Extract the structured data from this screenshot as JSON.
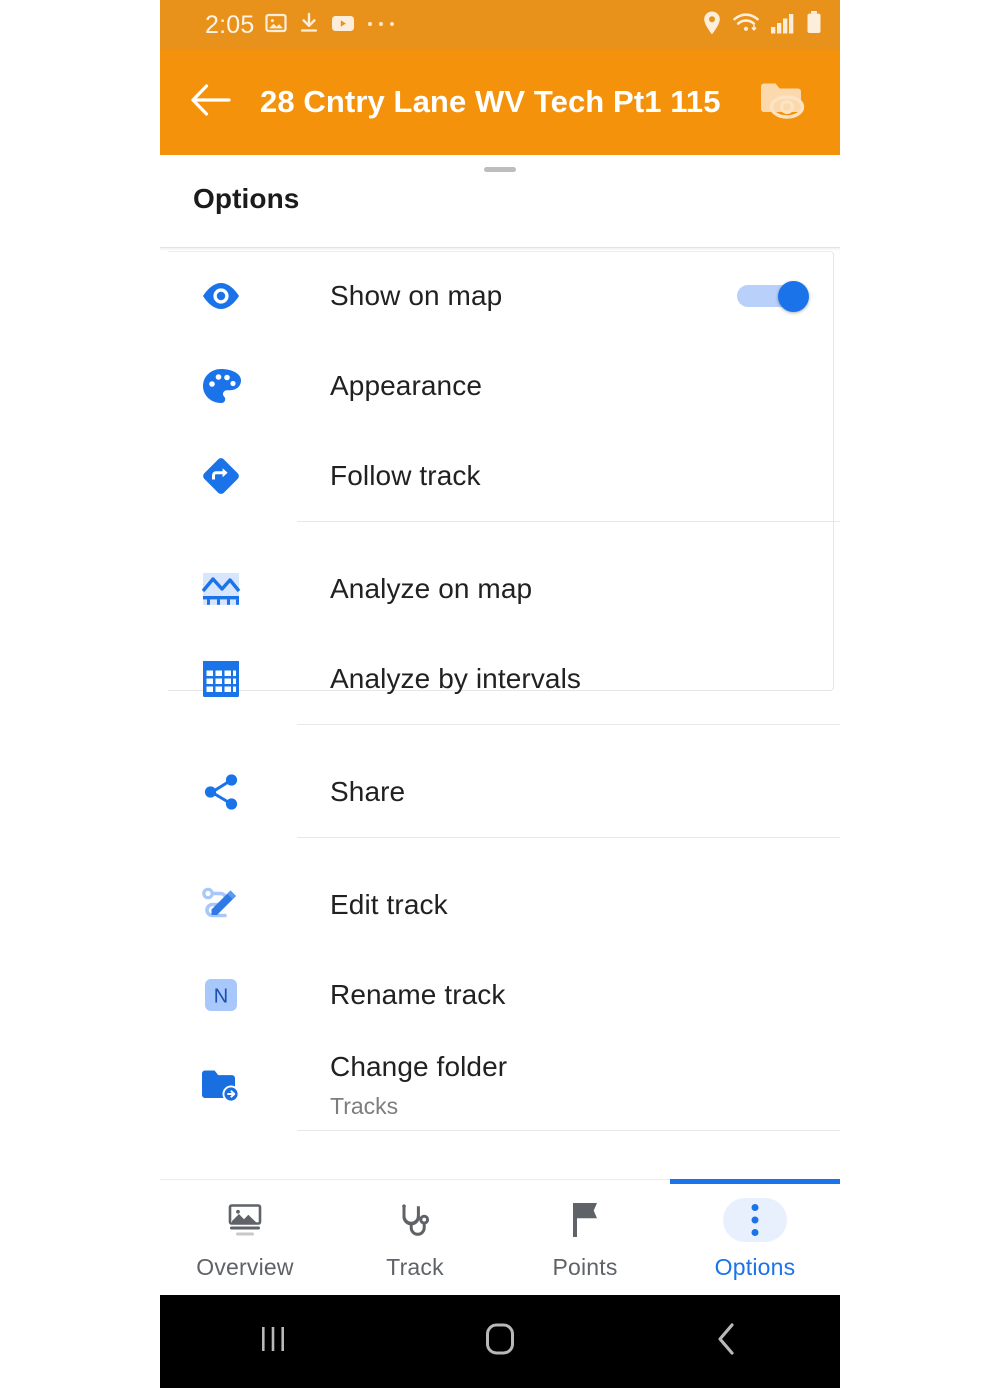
{
  "status_bar": {
    "time": "2:05",
    "left_icons": [
      "image-icon",
      "download-icon",
      "youtube-icon",
      "more-dots-icon"
    ],
    "right_icons": [
      "location-pin-icon",
      "wifi-icon",
      "signal-bars-icon",
      "battery-icon"
    ]
  },
  "app_bar": {
    "back_icon": "arrow-left-icon",
    "title": "28 Cntry Lane WV Tech Pt1 115",
    "action_icon": "folder-eye-icon"
  },
  "sheet": {
    "title": "Options"
  },
  "options": [
    {
      "id": "show-on-map",
      "icon": "eye-icon",
      "label": "Show on map",
      "subtitle": "",
      "control": "toggle",
      "toggle_on": true,
      "highlighted": true
    },
    {
      "id": "appearance",
      "icon": "palette-icon",
      "label": "Appearance",
      "subtitle": "",
      "control": "none"
    },
    {
      "id": "follow-track",
      "icon": "follow-track-icon",
      "label": "Follow track",
      "subtitle": "",
      "control": "none"
    },
    {
      "id": "analyze-on-map",
      "icon": "analyze-graph-icon",
      "label": "Analyze on map",
      "subtitle": "",
      "control": "none"
    },
    {
      "id": "analyze-by-intervals",
      "icon": "table-grid-icon",
      "label": "Analyze by intervals",
      "subtitle": "",
      "control": "none"
    },
    {
      "id": "share",
      "icon": "share-icon",
      "label": "Share",
      "subtitle": "",
      "control": "none"
    },
    {
      "id": "edit-track",
      "icon": "edit-track-icon",
      "label": "Edit track",
      "subtitle": "",
      "control": "none"
    },
    {
      "id": "rename-track",
      "icon": "rename-n-icon",
      "label": "Rename track",
      "subtitle": "",
      "control": "none"
    },
    {
      "id": "change-folder",
      "icon": "folder-move-icon",
      "label": "Change folder",
      "subtitle": "Tracks",
      "control": "none"
    }
  ],
  "bottom_nav": {
    "items": [
      {
        "id": "overview",
        "icon": "overview-image-icon",
        "label": "Overview",
        "active": false
      },
      {
        "id": "track",
        "icon": "track-route-icon",
        "label": "Track",
        "active": false
      },
      {
        "id": "points",
        "icon": "flag-icon",
        "label": "Points",
        "active": false
      },
      {
        "id": "options",
        "icon": "vertical-dots-icon",
        "label": "Options",
        "active": true
      }
    ]
  },
  "system_nav": {
    "recents_icon": "recents-icon",
    "home_icon": "home-icon",
    "back_icon": "system-back-icon"
  },
  "colors": {
    "app_bar": "#f5920b",
    "status_bar": "#e8921b",
    "accent": "#1a73e8",
    "accent_light": "#a8c7fa",
    "highlight_ring": "#ed2e2e",
    "text_primary": "#212121",
    "text_secondary": "#7d7d7d"
  }
}
